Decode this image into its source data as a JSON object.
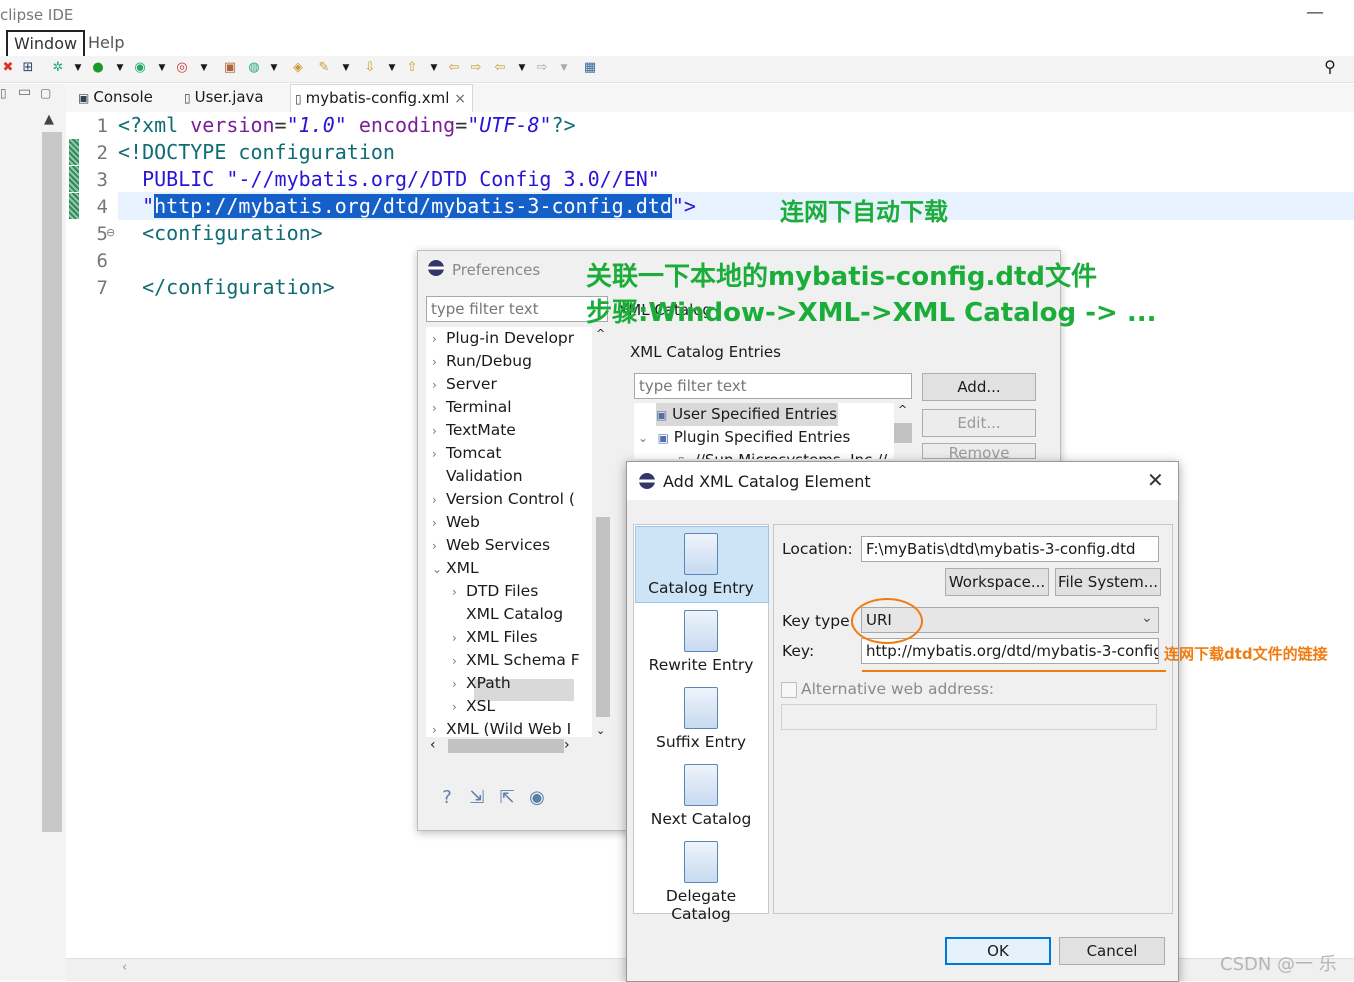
{
  "window": {
    "title": "clipse IDE",
    "minimize_glyph": "—"
  },
  "menu": {
    "window": "Window",
    "help": "Help"
  },
  "toolbar": {
    "search_icon": "search-icon"
  },
  "tabs": [
    {
      "label": "Console",
      "icon": "console-icon"
    },
    {
      "label": "User.java",
      "icon": "java-file-icon"
    },
    {
      "label": "mybatis-config.xml",
      "icon": "xml-file-icon",
      "close": "×"
    }
  ],
  "editor": {
    "line_numbers": [
      "1",
      "2",
      "3",
      "4",
      "5",
      "6",
      "7"
    ],
    "fold_marker": "⊖",
    "line1": {
      "open": "<?xml ",
      "a1": "version",
      "eq1": "=",
      "v1": "\"1.0\"",
      "sp": " ",
      "a2": "encoding",
      "eq2": "=",
      "v2": "\"UTF-8\"",
      "close": "?>"
    },
    "line2": "<!DOCTYPE configuration",
    "line3": "  PUBLIC \"-//mybatis.org//DTD Config 3.0//EN\"",
    "line4": {
      "pre": "  \"",
      "selected": "http://mybatis.org/dtd/mybatis-3-config.dtd",
      "post": "\">"
    },
    "line5": "  <configuration>",
    "line7": "  </configuration>"
  },
  "annotations": {
    "auto_download": "连网下自动下载",
    "associate_local": "关联一下本地的mybatis-config.dtd文件",
    "steps": "步骤:Window->XML->XML Catalog -> ...",
    "download_link": "连网下载dtd文件的链接"
  },
  "preferences": {
    "title": "Preferences",
    "filter_placeholder": "type filter text",
    "tree": [
      {
        "label": "Plug-in Developr",
        "indent": 0,
        "chev": "›"
      },
      {
        "label": "Run/Debug",
        "indent": 0,
        "chev": "›"
      },
      {
        "label": "Server",
        "indent": 0,
        "chev": "›"
      },
      {
        "label": "Terminal",
        "indent": 0,
        "chev": "›"
      },
      {
        "label": "TextMate",
        "indent": 0,
        "chev": "›"
      },
      {
        "label": "Tomcat",
        "indent": 0,
        "chev": "›"
      },
      {
        "label": "Validation",
        "indent": 0,
        "chev": ""
      },
      {
        "label": "Version Control (",
        "indent": 0,
        "chev": "›"
      },
      {
        "label": "Web",
        "indent": 0,
        "chev": "›"
      },
      {
        "label": "Web Services",
        "indent": 0,
        "chev": "›"
      },
      {
        "label": "XML",
        "indent": 0,
        "chev": "⌄"
      },
      {
        "label": "DTD Files",
        "indent": 1,
        "chev": "›"
      },
      {
        "label": "XML Catalog",
        "indent": 1,
        "chev": ""
      },
      {
        "label": "XML Files",
        "indent": 1,
        "chev": "›"
      },
      {
        "label": "XML Schema F",
        "indent": 1,
        "chev": "›"
      },
      {
        "label": "XPath",
        "indent": 1,
        "chev": "›"
      },
      {
        "label": "XSL",
        "indent": 1,
        "chev": "›"
      },
      {
        "label": "XML (Wild Web I",
        "indent": 0,
        "chev": "›"
      }
    ],
    "page_title": "XML Catalog",
    "group_label": "XML Catalog Entries",
    "entries_filter_placeholder": "type filter text",
    "entries": [
      {
        "label": "User Specified Entries",
        "chev": ""
      },
      {
        "label": "Plugin Specified Entries",
        "chev": "⌄"
      },
      {
        "label": "-//Sun Microsystems, Inc.//",
        "chev": ""
      }
    ],
    "buttons": {
      "add": "Add...",
      "edit": "Edit...",
      "remove": "Remove"
    },
    "bottom_icons": [
      "help-icon",
      "import-icon",
      "export-icon",
      "record-icon"
    ]
  },
  "add_dialog": {
    "title": "Add XML Catalog Element",
    "close": "✕",
    "side_items": [
      "Catalog Entry",
      "Rewrite Entry",
      "Suffix Entry",
      "Next Catalog",
      "Delegate Catalog"
    ],
    "location_label": "Location:",
    "location_value": "F:\\myBatis\\dtd\\mybatis-3-config.dtd",
    "workspace_btn": "Workspace...",
    "filesystem_btn": "File System...",
    "keytype_label": "Key type:",
    "keytype_value": "URI",
    "key_label": "Key:",
    "key_value": "http://mybatis.org/dtd/mybatis-3-config",
    "alt_label": "Alternative web address:",
    "ok": "OK",
    "cancel": "Cancel"
  },
  "watermark": "CSDN @一 乐"
}
